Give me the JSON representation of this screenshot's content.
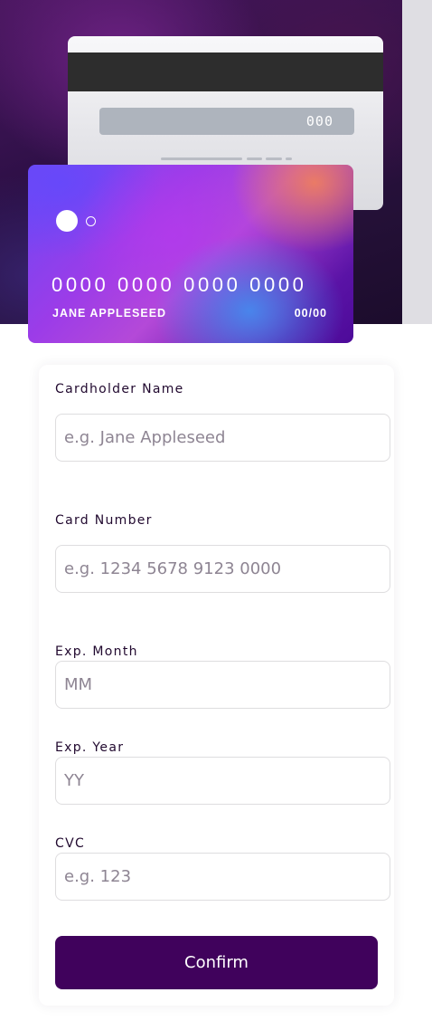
{
  "card_back": {
    "cvc": "000"
  },
  "card_front": {
    "number": "0000 0000 0000 0000",
    "holder": "JANE APPLESEED",
    "expiry": "00/00"
  },
  "form": {
    "name": {
      "label": "Cardholder Name",
      "placeholder": "e.g. Jane Appleseed",
      "value": ""
    },
    "number": {
      "label": "Card Number",
      "placeholder": "e.g. 1234 5678 9123 0000",
      "value": ""
    },
    "month": {
      "label": "Exp. Month",
      "placeholder": "MM",
      "value": ""
    },
    "year": {
      "label": "Exp. Year",
      "placeholder": "YY",
      "value": ""
    },
    "cvc": {
      "label": "CVC",
      "placeholder": "e.g. 123",
      "value": ""
    },
    "confirm_label": "Confirm"
  },
  "colors": {
    "accent": "#40025c",
    "text": "#21092f",
    "placeholder": "#8e8593",
    "border": "#dedddf",
    "card_back_magstripe": "#2d2d2d",
    "card_back_cvc_box": "#aeb4bd"
  },
  "icons": {
    "card_logo_large": "filled-circle",
    "card_logo_small": "outline-circle"
  }
}
